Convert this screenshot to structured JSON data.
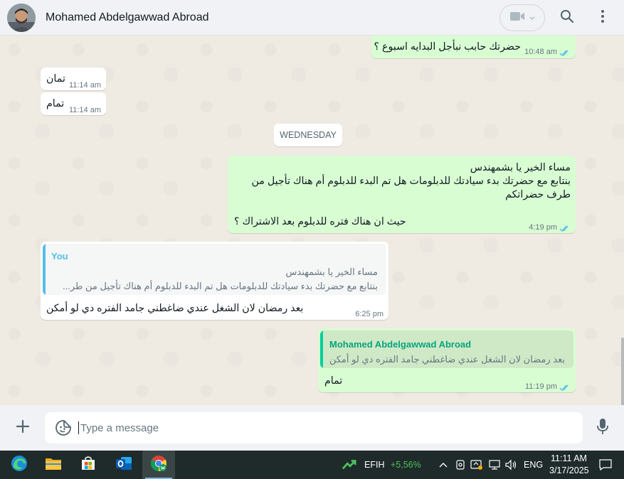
{
  "header": {
    "contact_name": "Mohamed Abdelgawwad Abroad",
    "icons": [
      "avatar",
      "video-call-icon",
      "chevron-down-icon",
      "search-icon",
      "menu-icon"
    ]
  },
  "messages": [
    {
      "direction": "out",
      "text": "حضرتك حابب نبأجل البدايه اسبوع ؟",
      "time": "10:48 am",
      "status": "read"
    },
    {
      "direction": "in",
      "text": "تمان",
      "time": "11:14 am"
    },
    {
      "direction": "in",
      "text": "تمام",
      "time": "11:14 am"
    },
    {
      "direction": "out",
      "lines": [
        "مساء الخير يا بشمهندس",
        "بنتابع مع حضرتك بدء سيادتك للدبلومات هل تم البدء للدبلوم أم هناك تأجيل من",
        "طرف حضراتكم",
        "حيث ان هناك فتره للدبلوم بعد الاشتراك ؟"
      ],
      "time": "4:19 pm",
      "status": "read"
    },
    {
      "direction": "in",
      "quote": {
        "author": "You",
        "line1": "مساء الخير يا بشمهندس",
        "line2": "بنتابع مع حضرتك بدء سيادتك للدبلومات هل تم البدء للدبلوم أم هناك تأجيل من طر..."
      },
      "text": "بعد رمضان لان الشغل عندي ضاغطني جامد الفتره دي لو أمكن",
      "time": "6:25 pm"
    },
    {
      "direction": "out",
      "quote": {
        "author": "Mohamed Abdelgawwad Abroad",
        "line1": "بعد رمضان لان الشغل عندي ضاغطني جامد الفتره دي لو أمكن"
      },
      "text": "تمام",
      "time": "11:19 pm",
      "status": "read"
    }
  ],
  "date_separator": "WEDNESDAY",
  "composer": {
    "placeholder": "Type a message",
    "icons": [
      "plus-icon",
      "sticker-icon",
      "microphone-icon"
    ]
  },
  "taskbar": {
    "apps": [
      "edge",
      "file-explorer",
      "microsoft-store",
      "outlook",
      "chrome"
    ],
    "stock_ticker": "EFIH",
    "stock_change": "+5,56%",
    "language": "ENG",
    "time": "11:11 AM",
    "date": "3/17/2025"
  },
  "colors": {
    "header_bg": "#f0f2f5",
    "chat_bg": "#efeae2",
    "outgoing_bubble": "#d9fdd3",
    "incoming_bubble": "#ffffff",
    "read_ticks": "#53bdeb",
    "quote_you": "#53bdeb",
    "quote_contact": "#06cf9c",
    "stock_up": "#4cc25b",
    "taskbar_bg": "#1f2a2a"
  }
}
